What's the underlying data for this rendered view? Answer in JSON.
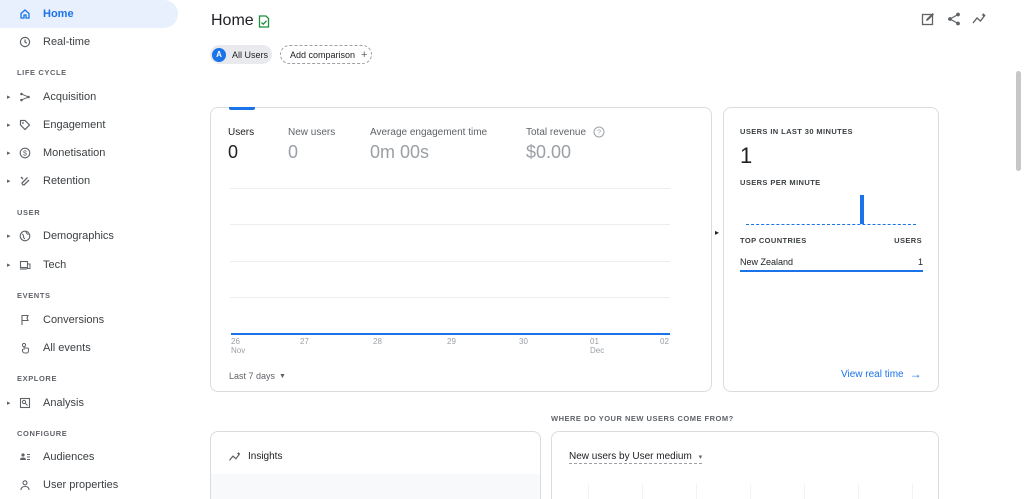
{
  "sidebar": {
    "items": [
      {
        "label": "Home",
        "icon": "home-icon",
        "active": true
      },
      {
        "label": "Real-time",
        "icon": "clock-icon"
      }
    ],
    "sections": [
      {
        "title": "LIFE CYCLE",
        "items": [
          {
            "label": "Acquisition",
            "icon": "acquisition-icon"
          },
          {
            "label": "Engagement",
            "icon": "tag-icon"
          },
          {
            "label": "Monetisation",
            "icon": "dollar-icon"
          },
          {
            "label": "Retention",
            "icon": "retention-icon"
          }
        ]
      },
      {
        "title": "USER",
        "items": [
          {
            "label": "Demographics",
            "icon": "globe-icon"
          },
          {
            "label": "Tech",
            "icon": "devices-icon"
          }
        ]
      },
      {
        "title": "EVENTS",
        "items": [
          {
            "label": "Conversions",
            "icon": "flag-icon"
          },
          {
            "label": "All events",
            "icon": "touch-icon"
          }
        ]
      },
      {
        "title": "EXPLORE",
        "items": [
          {
            "label": "Analysis",
            "icon": "analysis-icon"
          }
        ]
      },
      {
        "title": "CONFIGURE",
        "items": [
          {
            "label": "Audiences",
            "icon": "audiences-icon"
          },
          {
            "label": "User properties",
            "icon": "user-properties-icon"
          }
        ]
      }
    ]
  },
  "header": {
    "title": "Home",
    "icons": [
      "edit-report-icon",
      "share-icon",
      "insights-icon"
    ]
  },
  "comparison": {
    "avatar_letter": "A",
    "segment": "All Users",
    "add": "Add comparison",
    "add_glyph": "+"
  },
  "metrics": {
    "items": [
      {
        "label": "Users",
        "value": "0"
      },
      {
        "label": "New users",
        "value": "0"
      },
      {
        "label": "Average engagement time",
        "value": "0m 00s"
      },
      {
        "label": "Total revenue",
        "value": "$0.00"
      }
    ],
    "range": "Last 7 days"
  },
  "chart_data": {
    "type": "line",
    "categories": [
      "26 Nov",
      "27",
      "28",
      "29",
      "30",
      "01 Dec",
      "02"
    ],
    "series": [
      {
        "values": [
          0,
          0,
          0,
          0,
          0,
          0,
          0
        ]
      }
    ],
    "x_ticks": [
      {
        "top": "26",
        "bottom": "Nov"
      },
      {
        "top": "27",
        "bottom": ""
      },
      {
        "top": "28",
        "bottom": ""
      },
      {
        "top": "29",
        "bottom": ""
      },
      {
        "top": "30",
        "bottom": ""
      },
      {
        "top": "01",
        "bottom": "Dec"
      },
      {
        "top": "02",
        "bottom": ""
      }
    ],
    "grid": true,
    "color": "#1a73e8"
  },
  "realtime": {
    "users_title": "USERS IN LAST 30 MINUTES",
    "users_value": "1",
    "per_minute_title": "USERS PER MINUTE",
    "countries_title": "TOP COUNTRIES",
    "users_col": "USERS",
    "countries": [
      {
        "name": "New Zealand",
        "value": "1"
      }
    ],
    "link": "View real time",
    "link_arrow": "→"
  },
  "acquisition": {
    "question": "WHERE DO YOUR NEW USERS COME FROM?",
    "select": "New users by User medium",
    "select_arrow": "▾"
  },
  "insights": {
    "title": "Insights"
  },
  "colors": {
    "accent": "#1a73e8",
    "active_bg": "#e8f0fe",
    "badge_green": "#1e8e3e"
  }
}
